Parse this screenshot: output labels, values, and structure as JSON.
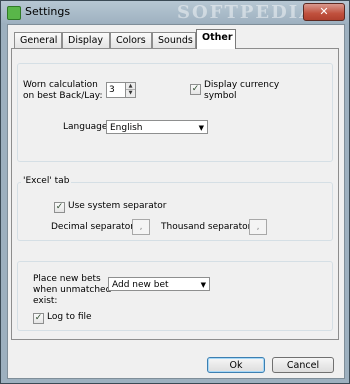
{
  "window": {
    "title": "Settings",
    "watermark": "SOFTPEDIA",
    "close_glyph": "✕"
  },
  "tabs": [
    {
      "label": "General",
      "active": false
    },
    {
      "label": "Display",
      "active": false
    },
    {
      "label": "Colors",
      "active": false
    },
    {
      "label": "Sounds",
      "active": false
    },
    {
      "label": "Other",
      "active": true
    }
  ],
  "other": {
    "worn_label_1": "Worn calculation",
    "worn_label_2": "on best Back/Lay:",
    "worn_value": "3",
    "display_currency_1": "Display currency",
    "display_currency_2": "symbol",
    "display_currency_checked": true,
    "language_label": "Language:",
    "language_value": "English",
    "excel_group_label": "'Excel' tab",
    "use_system_sep_label": "Use system separator",
    "use_system_sep_checked": true,
    "decimal_sep_label": "Decimal separator:",
    "decimal_sep_value": ",",
    "thousand_sep_label": "Thousand separator:",
    "thousand_sep_value": ",",
    "place_bets_1": "Place new bets",
    "place_bets_2": "when unmatched",
    "place_bets_3": "exist:",
    "place_bets_value": "Add new bet",
    "log_label": "Log to file",
    "log_checked": true
  },
  "buttons": {
    "ok": "Ok",
    "cancel": "Cancel"
  }
}
